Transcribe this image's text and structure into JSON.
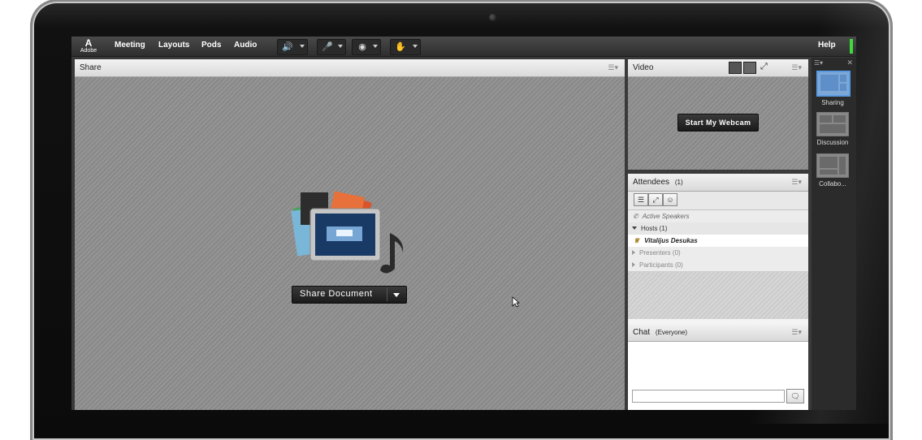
{
  "menubar": {
    "logo_letter": "A",
    "logo_text": "Adobe",
    "items": [
      "Meeting",
      "Layouts",
      "Pods",
      "Audio"
    ],
    "help": "Help"
  },
  "share_pod": {
    "title": "Share",
    "button_label": "Share Document"
  },
  "video_pod": {
    "title": "Video",
    "webcam_button": "Start My Webcam"
  },
  "attendees_pod": {
    "title": "Attendees",
    "count": "(1)",
    "active_speakers": "Active Speakers",
    "groups": [
      {
        "label": "Hosts (1)",
        "expanded": true
      },
      {
        "label": "Presenters (0)",
        "expanded": false
      },
      {
        "label": "Participants (0)",
        "expanded": false
      }
    ],
    "host_name": "Vitalijus Desukas"
  },
  "chat_pod": {
    "title": "Chat",
    "scope": "(Everyone)"
  },
  "layouts": [
    {
      "label": "Sharing",
      "active": true
    },
    {
      "label": "Discussion",
      "active": false
    },
    {
      "label": "Collabo...",
      "active": false
    }
  ],
  "colors": {
    "audio_active": "#3ddc3a",
    "layout_active": "#5a9be6"
  }
}
